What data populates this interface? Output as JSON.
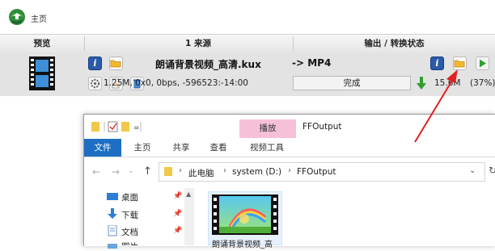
{
  "toolbar": {
    "home_label": "主页"
  },
  "columns": {
    "preview": "预览",
    "source": "1 来源",
    "output": "输出 / 转换状态"
  },
  "task": {
    "filename": "朗诵背景视频_高清.kux",
    "info": "1.25M, 0x0, 0bps, -596523:-14:00",
    "target_format": "-> MP4",
    "status": "完成",
    "output_size": "15.6M",
    "percent": "(37%)"
  },
  "explorer": {
    "context_tab": "播放",
    "window_title": "FFOutput",
    "ribbon_tabs": [
      "文件",
      "主页",
      "共享",
      "查看",
      "视频工具"
    ],
    "breadcrumb": [
      "此电脑",
      "system (D:)",
      "FFOutput"
    ],
    "nav_items": [
      "桌面",
      "下载",
      "文档",
      "图片"
    ],
    "file_label": "朗诵背景视频_高"
  },
  "colors": {
    "file_tab": "#1e6fc4",
    "context_tab": "#f6c1d8",
    "row_bg": "#e3e3e3",
    "annotation_arrow": "#e02020"
  }
}
